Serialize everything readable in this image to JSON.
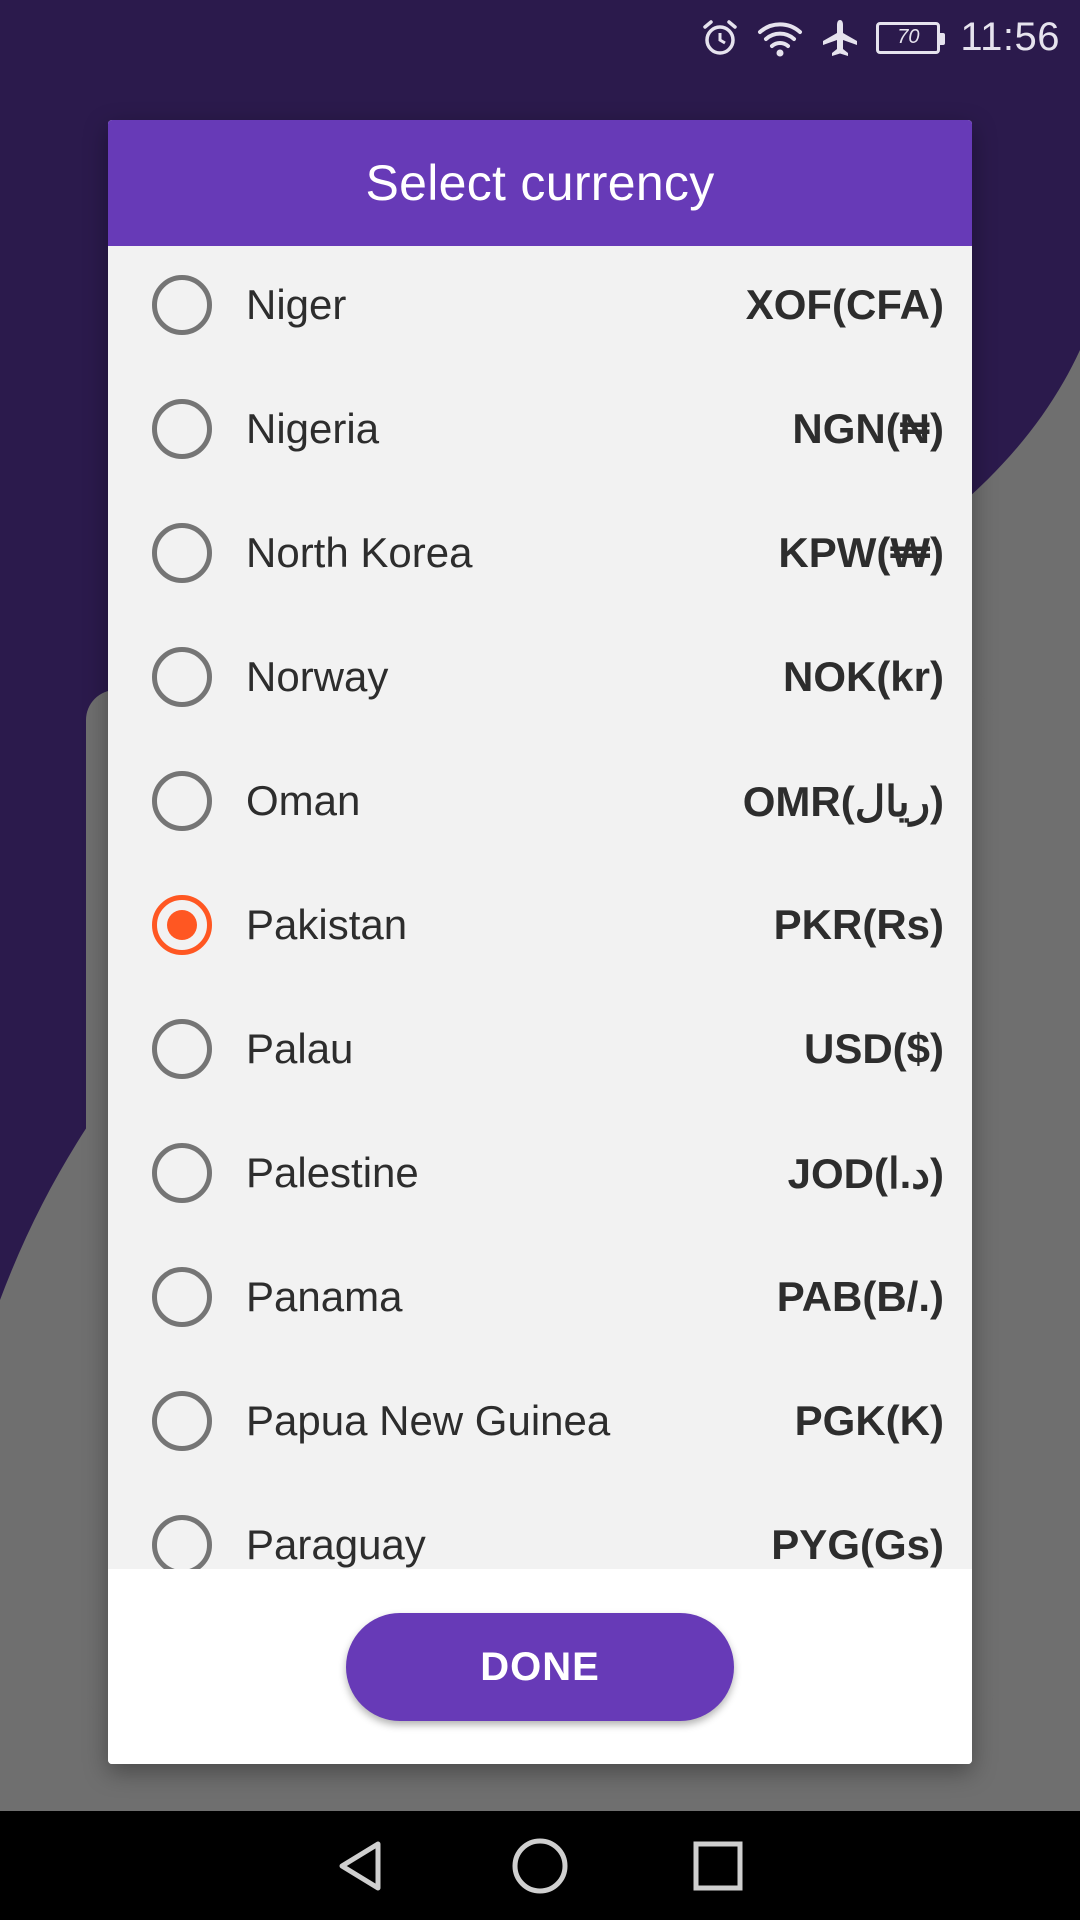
{
  "status_bar": {
    "battery_level": "70",
    "time": "11:56",
    "icons": [
      "alarm-icon",
      "wifi-icon",
      "airplane-icon",
      "battery-icon"
    ]
  },
  "dialog": {
    "title": "Select currency",
    "done_label": "DONE",
    "items": [
      {
        "country": "Niger",
        "currency": "XOF(CFA)",
        "selected": false
      },
      {
        "country": "Nigeria",
        "currency": "NGN(₦)",
        "selected": false
      },
      {
        "country": "North Korea",
        "currency": "KPW(₩)",
        "selected": false
      },
      {
        "country": "Norway",
        "currency": "NOK(kr)",
        "selected": false
      },
      {
        "country": "Oman",
        "currency": "OMR(ريال)",
        "selected": false
      },
      {
        "country": "Pakistan",
        "currency": "PKR(Rs)",
        "selected": true
      },
      {
        "country": "Palau",
        "currency": "USD($)",
        "selected": false
      },
      {
        "country": "Palestine",
        "currency": "JOD(د.ا)",
        "selected": false
      },
      {
        "country": "Panama",
        "currency": "PAB(B/.)",
        "selected": false
      },
      {
        "country": "Papua New Guinea",
        "currency": "PGK(K)",
        "selected": false
      },
      {
        "country": "Paraguay",
        "currency": "PYG(Gs)",
        "selected": false
      }
    ]
  },
  "nav_bar": {
    "icons": [
      "back-icon",
      "home-icon",
      "recents-icon"
    ]
  },
  "colors": {
    "accent": "#673ab7",
    "selected_radio": "#ff5722",
    "background_dark": "#2b1a4c"
  }
}
